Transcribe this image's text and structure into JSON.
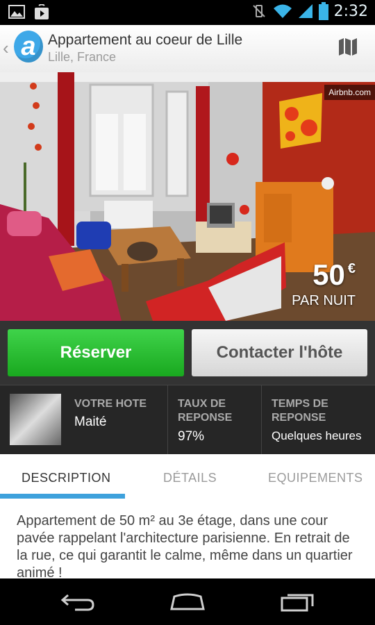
{
  "status_bar": {
    "time": "2:32"
  },
  "header": {
    "title": "Appartement au coeur de Lille",
    "subtitle": "Lille, France"
  },
  "photo": {
    "watermark": "Airbnb.com",
    "price": "50",
    "currency": "€",
    "per_night": "PAR NUIT"
  },
  "actions": {
    "book": "Réserver",
    "contact": "Contacter l'hôte"
  },
  "host": {
    "host_label": "VOTRE HOTE",
    "host_name": "Maité",
    "rate_label": "TAUX DE REPONSE",
    "rate_value": "97%",
    "time_label": "TEMPS DE REPONSE",
    "time_value": "Quelques heures"
  },
  "tabs": [
    "DESCRIPTION",
    "DÉTAILS",
    "EQUIPEMENTS"
  ],
  "description": "Appartement de 50 m² au 3e étage, dans une cour pavée rappelant l'architecture parisienne. En retrait de la rue, ce qui garantit le calme, même dans un quartier animé !",
  "colors": {
    "accent": "#3ea1dc",
    "book_green": "#22b52a",
    "dark_bar": "#333333"
  }
}
